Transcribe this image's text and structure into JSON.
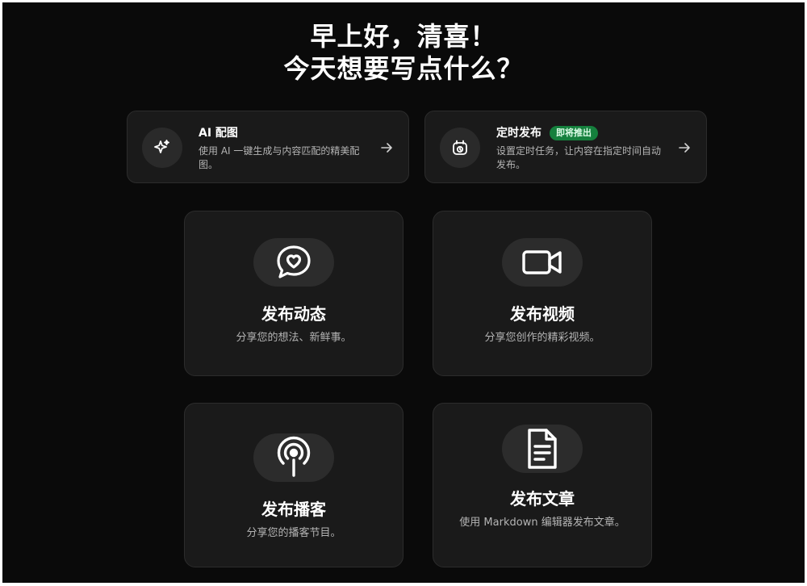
{
  "greeting": {
    "line1": "早上好，清喜！",
    "line2": "今天想要写点什么？"
  },
  "features": {
    "ai_image": {
      "title": "AI 配图",
      "description": "使用 AI 一键生成与内容匹配的精美配图。",
      "icon": "sparkle-icon"
    },
    "schedule": {
      "title": "定时发布",
      "badge": "即将推出",
      "description": "设置定时任务，让内容在指定时间自动发布。",
      "icon": "alarm-clock-icon"
    }
  },
  "actions": {
    "post": {
      "title": "发布动态",
      "description": "分享您的想法、新鲜事。",
      "icon": "chat-heart-icon"
    },
    "video": {
      "title": "发布视频",
      "description": "分享您创作的精彩视频。",
      "icon": "video-camera-icon"
    },
    "podcast": {
      "title": "发布播客",
      "description": "分享您的播客节目。",
      "icon": "podcast-icon"
    },
    "article": {
      "title": "发布文章",
      "description": "使用 Markdown 编辑器发布文章。",
      "icon": "document-icon"
    }
  },
  "colors": {
    "background": "#0a0a0a",
    "card": "#1a1a1a",
    "badge": "#15803d",
    "text": "#ffffff",
    "muted_text": "#b4b4b4"
  }
}
